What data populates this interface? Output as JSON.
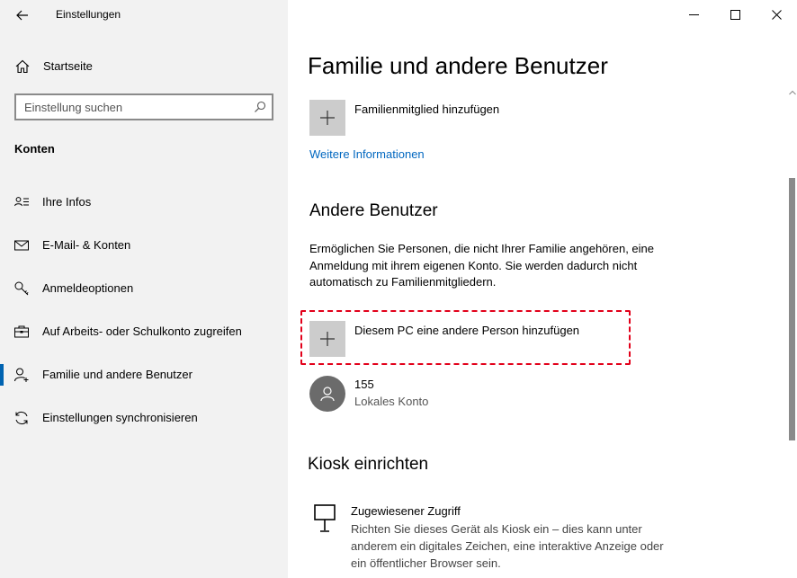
{
  "app": {
    "title": "Einstellungen"
  },
  "sidebar": {
    "home_label": "Startseite",
    "search_placeholder": "Einstellung suchen",
    "section_title": "Konten",
    "items": [
      {
        "label": "Ihre Infos",
        "icon": "person-card-icon"
      },
      {
        "label": "E-Mail- & Konten",
        "icon": "mail-icon"
      },
      {
        "label": "Anmeldeoptionen",
        "icon": "key-icon"
      },
      {
        "label": "Auf Arbeits- oder Schulkonto zugreifen",
        "icon": "briefcase-icon"
      },
      {
        "label": "Familie und andere Benutzer",
        "icon": "person-add-icon",
        "active": true
      },
      {
        "label": "Einstellungen synchronisieren",
        "icon": "sync-icon"
      }
    ]
  },
  "main": {
    "title": "Familie und andere Benutzer",
    "family_add_label": "Familienmitglied hinzufügen",
    "more_info_link": "Weitere Informationen",
    "other_users": {
      "heading": "Andere Benutzer",
      "description_lines": [
        "Ermöglichen Sie Personen, die nicht Ihrer Familie angehören, eine",
        "Anmeldung mit ihrem eigenen Konto. Sie werden dadurch nicht",
        "automatisch zu Familienmitgliedern."
      ],
      "add_person_label": "Diesem PC eine andere Person hinzufügen",
      "user": {
        "name": "155",
        "account_type": "Lokales Konto"
      }
    },
    "kiosk": {
      "heading": "Kiosk einrichten",
      "title": "Zugewiesener Zugriff",
      "description_lines": [
        "Richten Sie dieses Gerät als Kiosk ein – dies kann unter",
        "anderem ein digitales Zeichen, eine interaktive Anzeige oder",
        "ein öffentlicher Browser sein."
      ]
    }
  },
  "colors": {
    "accent": "#0063b1",
    "link": "#0067c0",
    "highlight_border": "#e2001a",
    "sidebar_bg": "#f2f2f2",
    "tile_bg": "#cccccc"
  }
}
